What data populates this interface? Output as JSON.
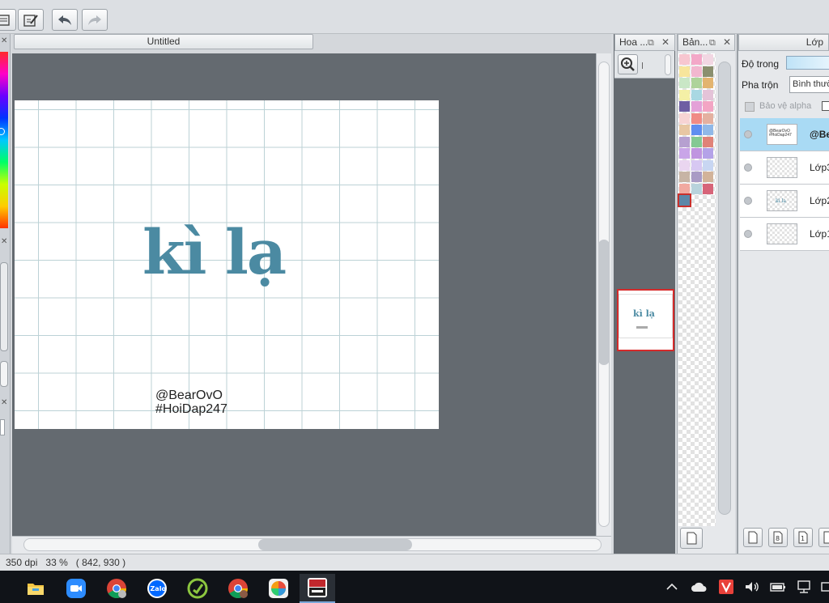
{
  "document": {
    "tab_title": "Untitled",
    "artwork_title": "kì lạ",
    "credit_line1": "@BearOvO",
    "credit_line2": "#HoiDap247"
  },
  "navigator": {
    "title": "Hoa ..."
  },
  "swatches": {
    "title": "Bản...",
    "colors": [
      "#f7c6d0",
      "#f3a8c8",
      "#f2d7e3",
      "#f7e59c",
      "#f2b7cf",
      "#8a8f6e",
      "#c9e7c6",
      "#aed39a",
      "#e3b46f",
      "#f4f0a6",
      "#a9d8e3",
      "#e4c3d8",
      "#6e5ea3",
      "#e4a1d8",
      "#f3a5c4",
      "#f7d4d4",
      "#f08b86",
      "#e4b0a0",
      "#e8c7a3",
      "#5f8ef0",
      "#90b8e8",
      "#b6a0d0",
      "#84c993",
      "#e08278",
      "#c9a5e8",
      "#c095e0",
      "#b4a2e8",
      "#ead6f0",
      "#d7c8f2",
      "#c8d6f2",
      "#c7b4a5",
      "#a99bc5",
      "#d2b39a",
      "#f1a9a0",
      "#b8d3dc",
      "#d76479",
      "#5c87a8"
    ]
  },
  "layers": {
    "title": "Lớp",
    "opacity_label": "Độ trong",
    "blend_label": "Pha trộn",
    "blend_value": "Bình thường",
    "protect_alpha_label": "Bảo vệ alpha",
    "items": [
      {
        "name": "@Be",
        "thumb_text": "@BearOvO #HoiDap247",
        "selected": true
      },
      {
        "name": "Lớp3",
        "thumb_text": "",
        "selected": false
      },
      {
        "name": "Lớp2",
        "thumb_text": "kì lạ",
        "selected": false
      },
      {
        "name": "Lớp1",
        "thumb_text": "",
        "selected": false
      }
    ]
  },
  "status": {
    "dpi": "350 dpi",
    "zoom": "33 %",
    "coords": "( 842, 930 )"
  },
  "colors": {
    "artwork_ink": "#4b8aa2",
    "canvas_bg": "#646a70",
    "selected_layer": "#a9daf4",
    "taskbar_bg": "#101318"
  }
}
